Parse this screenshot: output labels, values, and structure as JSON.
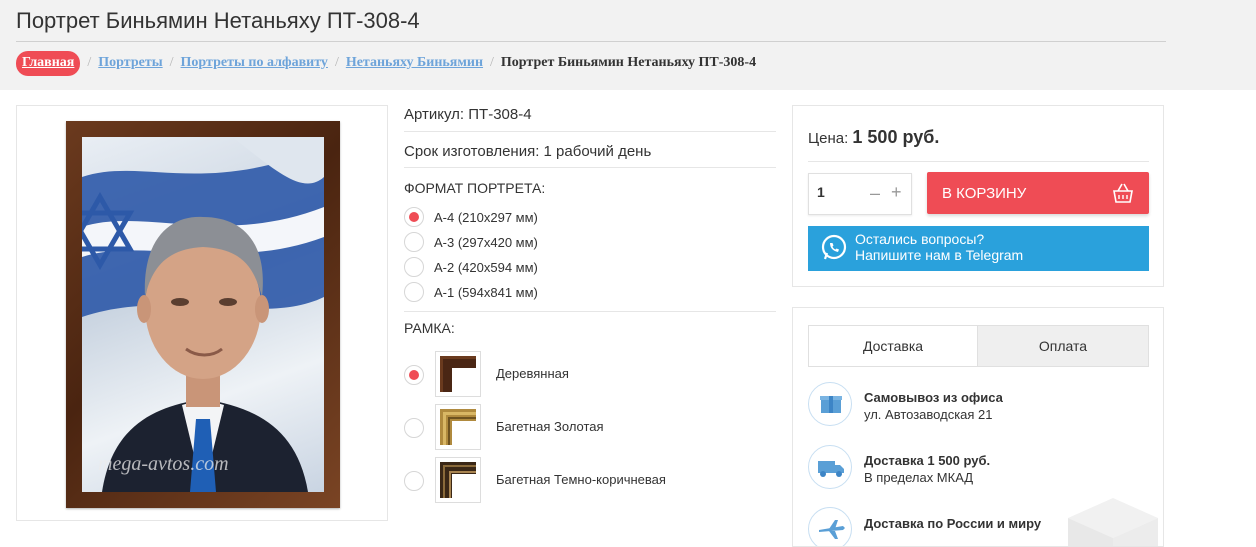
{
  "page": {
    "title": "Портрет Биньямин Нетаньяху ПТ-308-4"
  },
  "breadcrumb": {
    "items": [
      "Главная",
      "Портреты",
      "Портреты по алфавиту",
      "Нетаньяху Биньямин"
    ],
    "current": "Портрет Биньямин Нетаньяху ПТ-308-4",
    "separator": "/"
  },
  "product_image": {
    "watermark": "mega-avtos.com"
  },
  "details": {
    "article": "Артикул: ПТ-308-4",
    "lead_time": "Срок изготовления: 1 рабочий день",
    "format_label": "ФОРМАТ ПОРТРЕТА:",
    "formats": [
      {
        "label": "А-4 (210x297 мм)",
        "selected": true
      },
      {
        "label": "А-3 (297x420 мм)",
        "selected": false
      },
      {
        "label": "А-2 (420x594 мм)",
        "selected": false
      },
      {
        "label": "А-1 (594x841 мм)",
        "selected": false
      }
    ],
    "frame_label": "РАМКА:",
    "frames": [
      {
        "label": "Деревянная",
        "selected": true,
        "color": "#4a2614"
      },
      {
        "label": "Багетная Золотая",
        "selected": false,
        "color": "#b08a3e"
      },
      {
        "label": "Багетная Темно-коричневая",
        "selected": false,
        "color": "#3a2716"
      }
    ]
  },
  "buy": {
    "price_label": "Цена:",
    "price_value": "1 500 руб.",
    "quantity": "1",
    "minus": "–",
    "plus": "+",
    "cart_label": "В КОРЗИНУ",
    "telegram_line1": "Остались вопросы?",
    "telegram_line2": "Напишите нам в Telegram"
  },
  "shipping": {
    "tabs": [
      "Доставка",
      "Оплата"
    ],
    "options": [
      {
        "title": "Самовывоз из офиса",
        "sub": "ул. Автозаводская 21",
        "icon": "box-icon"
      },
      {
        "title": "Доставка 1 500 руб.",
        "sub": "В пределах МКАД",
        "icon": "truck-icon"
      },
      {
        "title": "Доставка по России и миру",
        "sub": "",
        "icon": "plane-icon"
      }
    ]
  },
  "colors": {
    "accent": "#ef4c55",
    "link": "#6ea4da",
    "telegram": "#2aa1dc"
  }
}
